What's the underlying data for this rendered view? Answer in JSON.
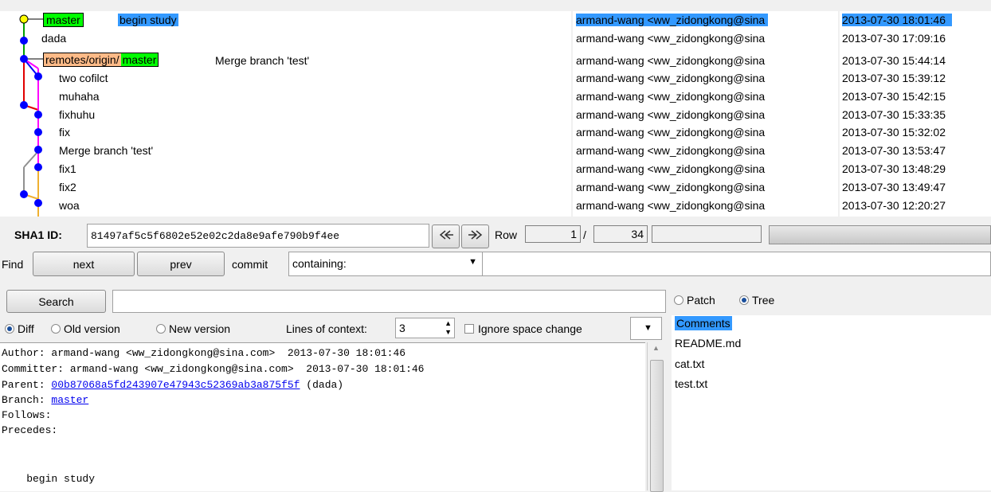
{
  "graph": {
    "rows": [
      {
        "subject": "begin study",
        "selected": true,
        "tags": [
          "master"
        ]
      },
      {
        "subject": "dada",
        "selected": false,
        "tags": []
      },
      {
        "subject": "Merge branch 'test'",
        "selected": false,
        "tags": [
          "remotes/origin/master"
        ]
      },
      {
        "subject": "two cofilct",
        "selected": false,
        "tags": []
      },
      {
        "subject": "muhaha",
        "selected": false,
        "tags": []
      },
      {
        "subject": "fixhuhu",
        "selected": false,
        "tags": []
      },
      {
        "subject": "fix",
        "selected": false,
        "tags": []
      },
      {
        "subject": "Merge branch 'test'",
        "selected": false,
        "tags": []
      },
      {
        "subject": "fix1",
        "selected": false,
        "tags": []
      },
      {
        "subject": "fix2",
        "selected": false,
        "tags": []
      },
      {
        "subject": "woa",
        "selected": false,
        "tags": []
      }
    ],
    "authors": [
      "armand-wang <ww_zidongkong@sina",
      "armand-wang <ww_zidongkong@sina",
      "armand-wang <ww_zidongkong@sina",
      "armand-wang <ww_zidongkong@sina",
      "armand-wang <ww_zidongkong@sina",
      "armand-wang <ww_zidongkong@sina",
      "armand-wang <ww_zidongkong@sina",
      "armand-wang <ww_zidongkong@sina",
      "armand-wang <ww_zidongkong@sina",
      "armand-wang <ww_zidongkong@sina",
      "armand-wang <ww_zidongkong@sina"
    ],
    "dates": [
      "2013-07-30 18:01:46",
      "2013-07-30 17:09:16",
      "2013-07-30 15:44:14",
      "2013-07-30 15:39:12",
      "2013-07-30 15:42:15",
      "2013-07-30 15:33:35",
      "2013-07-30 15:32:02",
      "2013-07-30 13:53:47",
      "2013-07-30 13:48:29",
      "2013-07-30 13:49:47",
      "2013-07-30 12:20:27"
    ],
    "tag_labels": {
      "master": "master",
      "remote_prefix": "remotes/origin/",
      "remote_branch": "master"
    }
  },
  "sha": {
    "label": "SHA1 ID:",
    "value": "81497af5c5f6802e52e02c2da8e9afe790b9f4ee"
  },
  "nav": {
    "back_icon": "double-left-arrow-icon",
    "forward_icon": "double-right-arrow-icon"
  },
  "row_counter": {
    "label": "Row",
    "current": "1",
    "separator": "/",
    "total": "34"
  },
  "find": {
    "label": "Find",
    "next": "next",
    "prev": "prev",
    "commit_label": "commit",
    "mode": "containing:"
  },
  "search": {
    "button": "Search",
    "value": ""
  },
  "view_mode": {
    "patch": "Patch",
    "tree": "Tree",
    "selected": "Tree"
  },
  "diff_options": {
    "diff": "Diff",
    "old_version": "Old version",
    "new_version": "New version",
    "selected": "Diff",
    "context_label": "Lines of context:",
    "context_value": "3",
    "ignore_space": "Ignore space change"
  },
  "details": {
    "author": "Author: armand-wang <ww_zidongkong@sina.com>  2013-07-30 18:01:46",
    "committer": "Committer: armand-wang <ww_zidongkong@sina.com>  2013-07-30 18:01:46",
    "parent_label": "Parent: ",
    "parent_hash": "00b87068a5fd243907e47943c52369ab3a875f5f",
    "parent_note": " (dada)",
    "branch_label": "Branch: ",
    "branch": "master",
    "follows": "Follows:",
    "precedes": "Precedes:",
    "message": "    begin study"
  },
  "tree": {
    "items": [
      "Comments",
      "README.md",
      "cat.txt",
      "test.txt"
    ],
    "selected": "Comments"
  }
}
